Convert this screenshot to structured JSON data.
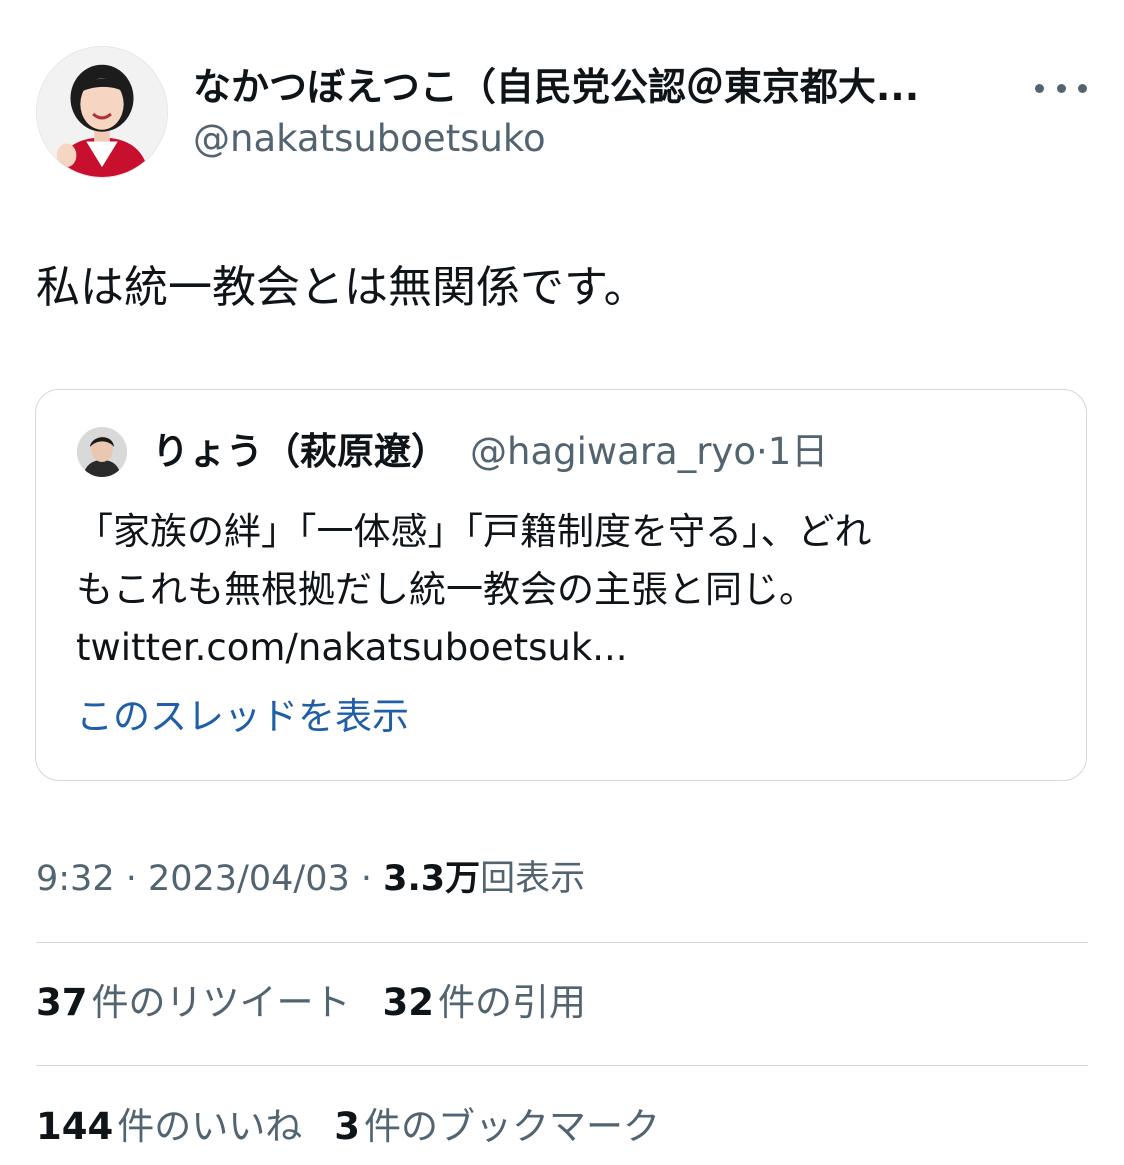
{
  "author": {
    "display_name": "なかつぼえつこ（自民党公認＠東京都大...",
    "handle": "@nakatsuboetsuko"
  },
  "more_icon": "more-horizontal-icon",
  "tweet": {
    "text": "私は統一教会とは無関係です。"
  },
  "quoted_tweet": {
    "display_name": "りょう（萩原遼）",
    "handle": "@hagiwara_ryo",
    "separator": "·",
    "time": "1日",
    "lines": [
      "「家族の絆」「一体感」「戸籍制度を守る」、どれ",
      "もこれも無根拠だし統一教会の主張と同じ。",
      "twitter.com/nakatsuboetsuk..."
    ],
    "show_thread_label": "このスレッドを表示"
  },
  "meta": {
    "time": "9:32",
    "sep1": " · ",
    "date": "2023/04/03",
    "sep2": " · ",
    "views_count": "3.3万",
    "views_label": "回表示"
  },
  "stats_row1": [
    {
      "count": "37",
      "label": "件のリツイート"
    },
    {
      "count": "32",
      "label": "件の引用"
    }
  ],
  "stats_row2": [
    {
      "count": "144",
      "label": "件のいいね"
    },
    {
      "count": "3",
      "label": "件のブックマーク"
    }
  ],
  "colors": {
    "text_primary": "#0f1419",
    "text_secondary": "#536471",
    "link": "#1f5fa8",
    "border": "#cfd9de",
    "accent_red": "#c8102e"
  }
}
